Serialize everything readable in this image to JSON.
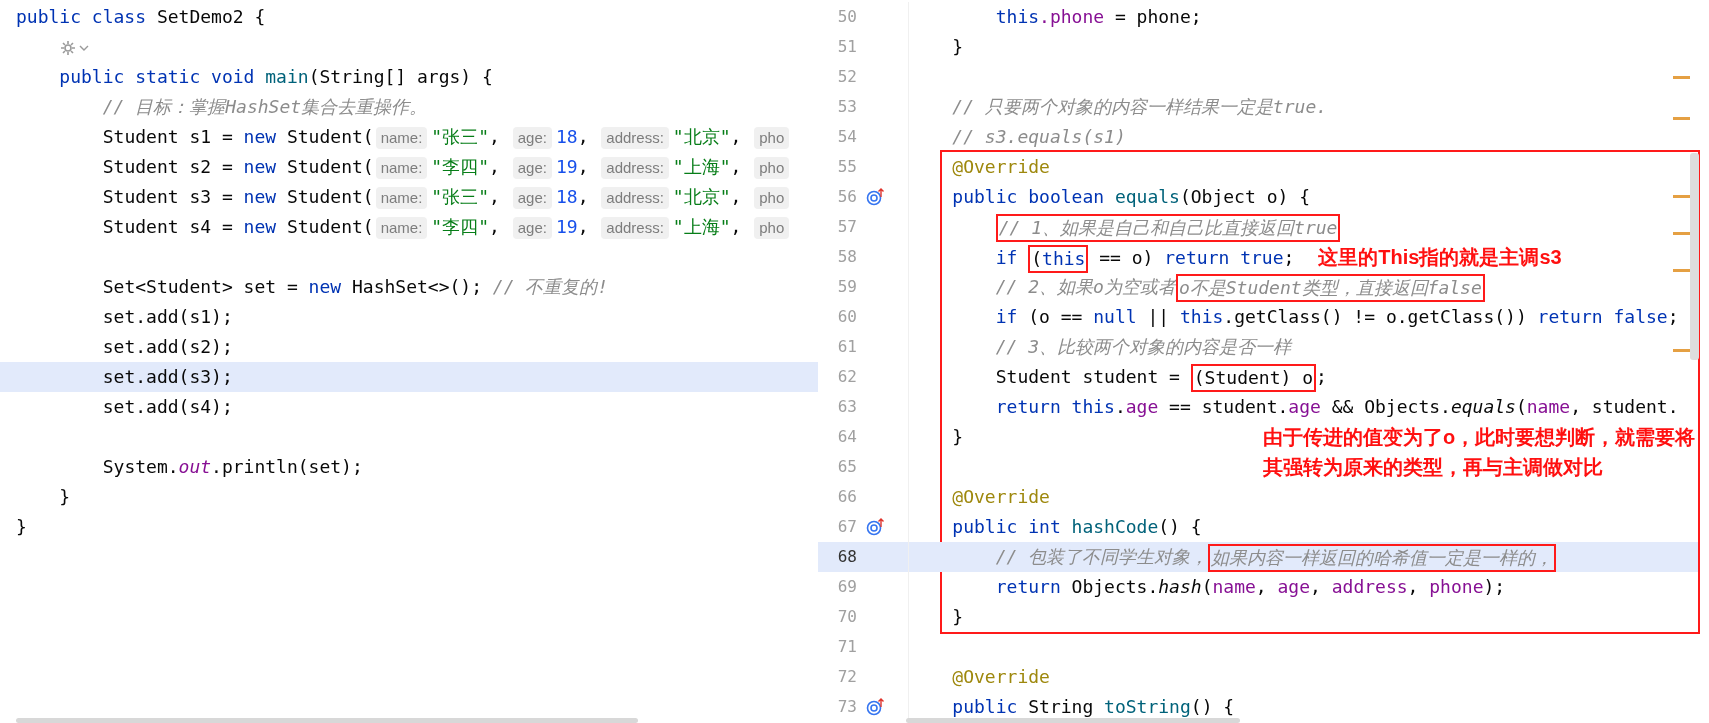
{
  "editor_left": {
    "lines": [
      {
        "current": false,
        "tokens": [
          {
            "kind": "keyword",
            "text": "public class"
          },
          {
            "kind": "plain",
            "text": " SetDemo2 {"
          }
        ]
      },
      {
        "current": false,
        "tokens": [
          {
            "kind": "icon"
          }
        ]
      },
      {
        "current": false,
        "tokens": [
          {
            "kind": "keyword",
            "text": "    public static void"
          },
          {
            "kind": "method",
            "text": " main"
          },
          {
            "kind": "plain",
            "text": "(String[] args) {"
          }
        ]
      },
      {
        "current": false,
        "tokens": [
          {
            "kind": "comment",
            "text": "        // 目标：掌握HashSet集合去重操作。"
          }
        ]
      },
      {
        "current": false,
        "tokens": [
          {
            "kind": "plain",
            "text": "        Student s1 = "
          },
          {
            "kind": "keyword",
            "text": "new"
          },
          {
            "kind": "plain",
            "text": " Student("
          },
          {
            "kind": "hint",
            "text": "name:"
          },
          {
            "kind": "string",
            "text": "\"张三\""
          },
          {
            "kind": "plain",
            "text": ", "
          },
          {
            "kind": "hint",
            "text": "age:"
          },
          {
            "kind": "number",
            "text": "18"
          },
          {
            "kind": "plain",
            "text": ", "
          },
          {
            "kind": "hint",
            "text": "address:"
          },
          {
            "kind": "string",
            "text": "\"北京\""
          },
          {
            "kind": "plain",
            "text": ", "
          },
          {
            "kind": "hint",
            "text": "pho"
          }
        ]
      },
      {
        "current": false,
        "tokens": [
          {
            "kind": "plain",
            "text": "        Student s2 = "
          },
          {
            "kind": "keyword",
            "text": "new"
          },
          {
            "kind": "plain",
            "text": " Student("
          },
          {
            "kind": "hint",
            "text": "name:"
          },
          {
            "kind": "string",
            "text": "\"李四\""
          },
          {
            "kind": "plain",
            "text": ", "
          },
          {
            "kind": "hint",
            "text": "age:"
          },
          {
            "kind": "number",
            "text": "19"
          },
          {
            "kind": "plain",
            "text": ", "
          },
          {
            "kind": "hint",
            "text": "address:"
          },
          {
            "kind": "string",
            "text": "\"上海\""
          },
          {
            "kind": "plain",
            "text": ", "
          },
          {
            "kind": "hint",
            "text": "pho"
          }
        ]
      },
      {
        "current": false,
        "tokens": [
          {
            "kind": "plain",
            "text": "        Student s3 = "
          },
          {
            "kind": "keyword",
            "text": "new"
          },
          {
            "kind": "plain",
            "text": " Student("
          },
          {
            "kind": "hint",
            "text": "name:"
          },
          {
            "kind": "string",
            "text": "\"张三\""
          },
          {
            "kind": "plain",
            "text": ", "
          },
          {
            "kind": "hint",
            "text": "age:"
          },
          {
            "kind": "number",
            "text": "18"
          },
          {
            "kind": "plain",
            "text": ", "
          },
          {
            "kind": "hint",
            "text": "address:"
          },
          {
            "kind": "string",
            "text": "\"北京\""
          },
          {
            "kind": "plain",
            "text": ", "
          },
          {
            "kind": "hint",
            "text": "pho"
          }
        ]
      },
      {
        "current": false,
        "tokens": [
          {
            "kind": "plain",
            "text": "        Student s4 = "
          },
          {
            "kind": "keyword",
            "text": "new"
          },
          {
            "kind": "plain",
            "text": " Student("
          },
          {
            "kind": "hint",
            "text": "name:"
          },
          {
            "kind": "string",
            "text": "\"李四\""
          },
          {
            "kind": "plain",
            "text": ", "
          },
          {
            "kind": "hint",
            "text": "age:"
          },
          {
            "kind": "number",
            "text": "19"
          },
          {
            "kind": "plain",
            "text": ", "
          },
          {
            "kind": "hint",
            "text": "address:"
          },
          {
            "kind": "string",
            "text": "\"上海\""
          },
          {
            "kind": "plain",
            "text": ", "
          },
          {
            "kind": "hint",
            "text": "pho"
          }
        ]
      },
      {
        "current": false
      },
      {
        "current": false,
        "tokens": [
          {
            "kind": "plain",
            "text": "        Set<Student> set = "
          },
          {
            "kind": "keyword",
            "text": "new"
          },
          {
            "kind": "plain",
            "text": " HashSet<>(); "
          },
          {
            "kind": "comment",
            "text": "// 不重复的!"
          }
        ]
      },
      {
        "current": false,
        "tokens": [
          {
            "kind": "plain",
            "text": "        set.add(s1);"
          }
        ]
      },
      {
        "current": false,
        "tokens": [
          {
            "kind": "plain",
            "text": "        set.add(s2);"
          }
        ]
      },
      {
        "current": true,
        "tokens": [
          {
            "kind": "plain",
            "text": "        set.add(s3);"
          }
        ]
      },
      {
        "current": false,
        "tokens": [
          {
            "kind": "plain",
            "text": "        set.add(s4);"
          }
        ]
      },
      {
        "current": false
      },
      {
        "current": false,
        "tokens": [
          {
            "kind": "plain",
            "text": "        System."
          },
          {
            "kind": "static_field",
            "text": "out"
          },
          {
            "kind": "plain",
            "text": ".println(set);"
          }
        ]
      },
      {
        "current": false,
        "tokens": [
          {
            "kind": "plain",
            "text": "    }"
          }
        ]
      },
      {
        "current": false,
        "tokens": [
          {
            "kind": "plain",
            "text": "}"
          }
        ]
      }
    ]
  },
  "editor_right": {
    "blocks": [
      {
        "kind": "plain",
        "lines": [
          {
            "number": "50",
            "current": false,
            "overrides": false,
            "tokens": [
              {
                "kind": "keyword",
                "text": "        this"
              },
              {
                "kind": "field",
                "text": ".phone"
              },
              {
                "kind": "plain",
                "text": " = phone;"
              }
            ]
          },
          {
            "number": "51",
            "current": false,
            "overrides": false,
            "tokens": [
              {
                "kind": "plain",
                "text": "    }"
              }
            ]
          },
          {
            "number": "52",
            "current": false,
            "overrides": false
          },
          {
            "number": "53",
            "current": false,
            "overrides": false,
            "tokens": [
              {
                "kind": "comment",
                "text": "    // 只要两个对象的内容一样结果一定是true."
              }
            ]
          },
          {
            "number": "54",
            "current": false,
            "overrides": false,
            "tokens": [
              {
                "kind": "comment",
                "text": "    // s3.equals(s1)"
              }
            ]
          }
        ]
      },
      {
        "kind": "boxed",
        "lines": [
          {
            "number": "55",
            "current": false,
            "overrides": false,
            "tokens": [
              {
                "kind": "annotation",
                "text": "    @Override"
              }
            ]
          },
          {
            "number": "56",
            "current": false,
            "overrides": true,
            "tokens": [
              {
                "kind": "keyword",
                "text": "    public boolean"
              },
              {
                "kind": "method",
                "text": " equals"
              },
              {
                "kind": "plain",
                "text": "(Object o) {"
              }
            ]
          },
          {
            "number": "57",
            "current": false,
            "overrides": false,
            "tokens": [
              {
                "kind": "boxed",
                "tokens": [
                  {
                    "kind": "comment",
                    "text": "        // 1、如果是自己和自己比直接返回true"
                  }
                ]
              }
            ]
          },
          {
            "number": "58",
            "current": false,
            "overrides": false,
            "tokens": [
              {
                "kind": "keyword",
                "text": "        if "
              },
              {
                "kind": "boxed",
                "tokens": [
                  {
                    "kind": "plain",
                    "text": "("
                  },
                  {
                    "kind": "keyword",
                    "text": "this"
                  }
                ]
              },
              {
                "kind": "plain",
                "text": " == o) "
              },
              {
                "kind": "keyword",
                "text": "return true"
              },
              {
                "kind": "plain",
                "text": ";"
              },
              {
                "kind": "note",
                "text": "这里的This指的就是主调s3"
              }
            ]
          },
          {
            "number": "59",
            "current": false,
            "overrides": false,
            "tokens": [
              {
                "kind": "comment",
                "text": "        // 2、如果o为空或者"
              },
              {
                "kind": "boxed",
                "tokens": [
                  {
                    "kind": "comment",
                    "text": "o不是Student类型，直接返回false"
                  }
                ]
              }
            ]
          },
          {
            "number": "60",
            "current": false,
            "overrides": false,
            "tokens": [
              {
                "kind": "keyword",
                "text": "        if"
              },
              {
                "kind": "plain",
                "text": " (o == "
              },
              {
                "kind": "keyword",
                "text": "null"
              },
              {
                "kind": "plain",
                "text": " || "
              },
              {
                "kind": "keyword",
                "text": "this"
              },
              {
                "kind": "plain",
                "text": ".getClass() != o.getClass()) "
              },
              {
                "kind": "keyword",
                "text": "return false"
              },
              {
                "kind": "plain",
                "text": ";"
              }
            ]
          },
          {
            "number": "61",
            "current": false,
            "overrides": false,
            "tokens": [
              {
                "kind": "comment",
                "text": "        // 3、比较两个对象的内容是否一样"
              }
            ]
          },
          {
            "number": "62",
            "current": false,
            "overrides": false,
            "tokens": [
              {
                "kind": "plain",
                "text": "        Student student = "
              },
              {
                "kind": "boxed",
                "tokens": [
                  {
                    "kind": "plain",
                    "text": "(Student) o"
                  }
                ]
              },
              {
                "kind": "plain",
                "text": ";"
              }
            ]
          },
          {
            "number": "63",
            "current": false,
            "overrides": false,
            "tokens": [
              {
                "kind": "keyword",
                "text": "        return this"
              },
              {
                "kind": "plain",
                "text": "."
              },
              {
                "kind": "field",
                "text": "age"
              },
              {
                "kind": "plain",
                "text": " == student."
              },
              {
                "kind": "field",
                "text": "age"
              },
              {
                "kind": "plain",
                "text": " && Objects."
              },
              {
                "kind": "static_method",
                "text": "equals"
              },
              {
                "kind": "plain",
                "text": "("
              },
              {
                "kind": "field",
                "text": "name"
              },
              {
                "kind": "plain",
                "text": ", student."
              }
            ]
          },
          {
            "number": "64",
            "current": false,
            "overrides": false,
            "tokens": [
              {
                "kind": "plain",
                "text": "    }"
              },
              {
                "kind": "note_block",
                "text": "由于传进的值变为了o，此时要想判断，就需要将其强转为原来的类型，再与主调做对比"
              }
            ]
          },
          {
            "number": "65",
            "current": false,
            "overrides": false
          },
          {
            "number": "66",
            "current": false,
            "overrides": false,
            "tokens": [
              {
                "kind": "annotation",
                "text": "    @Override"
              }
            ]
          },
          {
            "number": "67",
            "current": false,
            "overrides": true,
            "tokens": [
              {
                "kind": "keyword",
                "text": "    public int"
              },
              {
                "kind": "method",
                "text": " hashCode"
              },
              {
                "kind": "plain",
                "text": "() {"
              }
            ]
          },
          {
            "number": "68",
            "current": true,
            "overrides": false,
            "tokens": [
              {
                "kind": "comment",
                "text": "        // 包装了不同学生对象，"
              },
              {
                "kind": "boxed",
                "tokens": [
                  {
                    "kind": "comment",
                    "text": "如果内容一样返回的哈希值一定是一样的，"
                  }
                ]
              }
            ]
          },
          {
            "number": "69",
            "current": false,
            "overrides": false,
            "tokens": [
              {
                "kind": "keyword",
                "text": "        return"
              },
              {
                "kind": "plain",
                "text": " Objects."
              },
              {
                "kind": "static_method",
                "text": "hash"
              },
              {
                "kind": "plain",
                "text": "("
              },
              {
                "kind": "field",
                "text": "name"
              },
              {
                "kind": "plain",
                "text": ", "
              },
              {
                "kind": "field",
                "text": "age"
              },
              {
                "kind": "plain",
                "text": ", "
              },
              {
                "kind": "field",
                "text": "address"
              },
              {
                "kind": "plain",
                "text": ", "
              },
              {
                "kind": "field",
                "text": "phone"
              },
              {
                "kind": "plain",
                "text": ");"
              }
            ]
          },
          {
            "number": "70",
            "current": false,
            "overrides": false,
            "tokens": [
              {
                "kind": "plain",
                "text": "    }"
              }
            ]
          }
        ]
      },
      {
        "kind": "plain",
        "lines": [
          {
            "number": "71",
            "current": false,
            "overrides": false
          },
          {
            "number": "72",
            "current": false,
            "overrides": false,
            "tokens": [
              {
                "kind": "annotation",
                "text": "    @Override"
              }
            ]
          },
          {
            "number": "73",
            "current": false,
            "overrides": true,
            "tokens": [
              {
                "kind": "keyword",
                "text": "    public"
              },
              {
                "kind": "plain",
                "text": " String "
              },
              {
                "kind": "method",
                "text": "toString"
              },
              {
                "kind": "plain",
                "text": "() {"
              }
            ]
          }
        ]
      }
    ]
  }
}
